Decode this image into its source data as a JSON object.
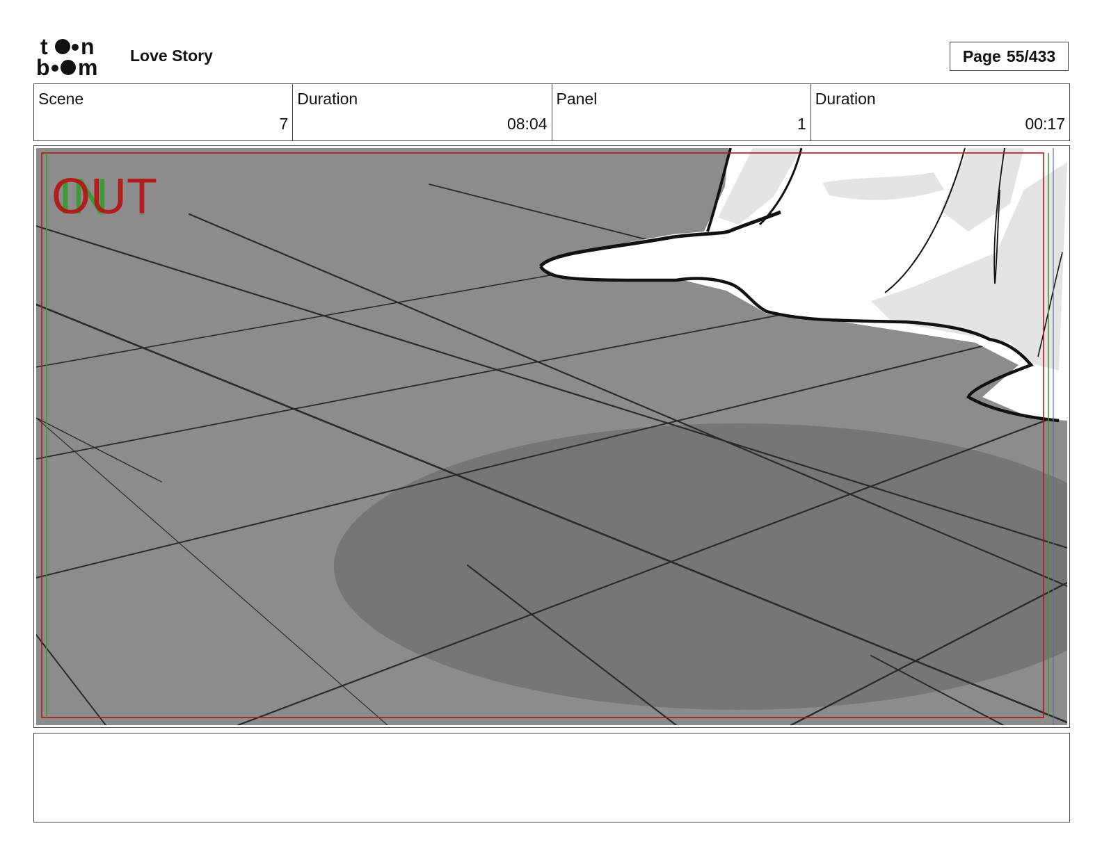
{
  "header": {
    "logo_text": "toon boom",
    "title": "Love Story",
    "page_label": "Page",
    "page_value": "55/433"
  },
  "info": {
    "scene_label": "Scene",
    "scene_value": "7",
    "scene_duration_label": "Duration",
    "scene_duration_value": "08:04",
    "panel_label": "Panel",
    "panel_value": "1",
    "panel_duration_label": "Duration",
    "panel_duration_value": "00:17"
  },
  "panel": {
    "in_marker": "IN",
    "out_marker": "OUT",
    "colors": {
      "floor": "#8c8c8c",
      "shadow": "#767676",
      "grid_line": "#2b2b2b",
      "in_green": "#3a9a34",
      "out_red": "#b51515"
    }
  },
  "notes": {
    "text": ""
  }
}
